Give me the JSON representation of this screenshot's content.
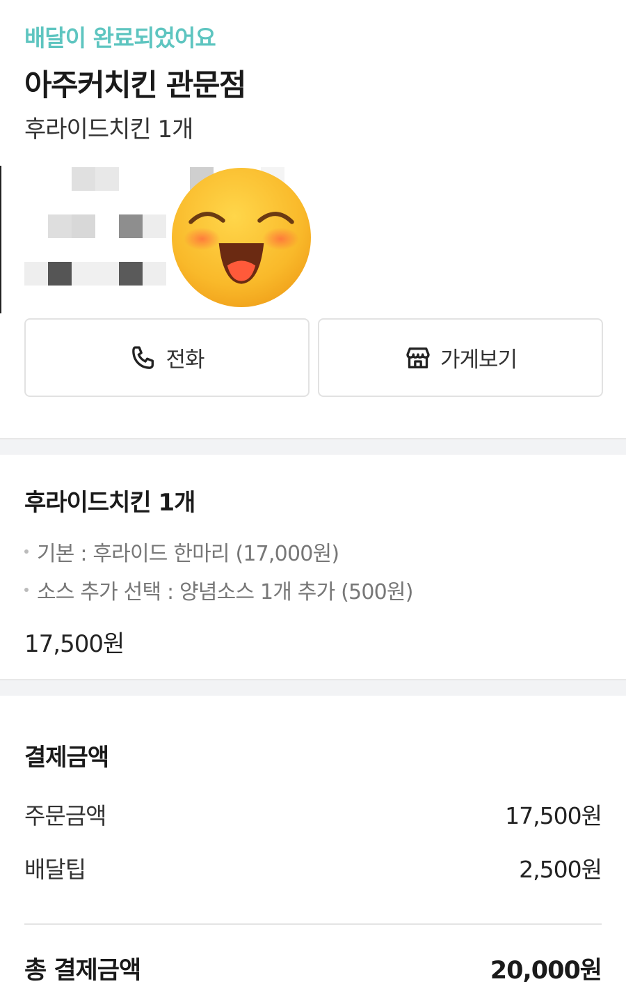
{
  "header": {
    "status": "배달이 완료되었어요",
    "store_name": "아주커치킨 관문점",
    "order_summary": "후라이드치킨 1개"
  },
  "actions": {
    "call_label": "전화",
    "store_label": "가게보기",
    "call_icon": "phone-icon",
    "store_icon": "store-icon"
  },
  "order_item": {
    "title": "후라이드치킨 1개",
    "options": [
      "기본 : 후라이드 한마리 (17,000원)",
      "소스 추가 선택 : 양념소스 1개 추가 (500원)"
    ],
    "price": "17,500원"
  },
  "payment": {
    "title": "결제금액",
    "rows": [
      {
        "label": "주문금액",
        "value": "17,500원"
      },
      {
        "label": "배달팁",
        "value": "2,500원"
      }
    ],
    "total_label": "총 결제금액",
    "total_value": "20,000원"
  },
  "colors": {
    "status_accent": "#5ec5c0",
    "divider": "#f2f3f5"
  }
}
